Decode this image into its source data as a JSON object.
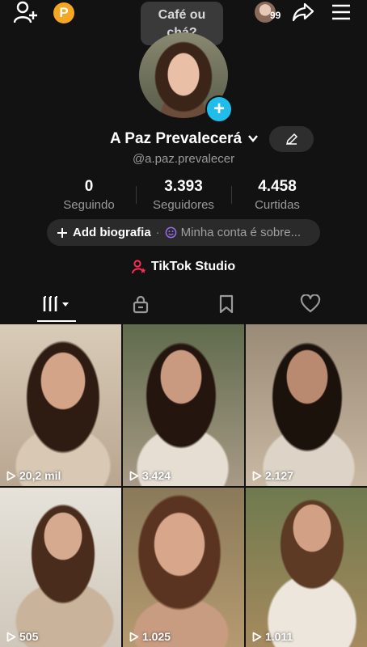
{
  "header": {
    "add_user_icon": "add-user-icon",
    "coin_label": "P",
    "notification_count": "99",
    "share_icon": "share-icon",
    "menu_icon": "hamburger-menu-icon"
  },
  "note_bubble": {
    "line1": "Café ou",
    "line2": "chá?"
  },
  "profile": {
    "display_name": "A Paz Prevalecerá",
    "username": "@a.paz.prevalecer"
  },
  "stats": [
    {
      "value": "0",
      "label": "Seguindo"
    },
    {
      "value": "3.393",
      "label": "Seguidores"
    },
    {
      "value": "4.458",
      "label": "Curtidas"
    }
  ],
  "bio": {
    "add_label": "Add biografia",
    "separator": "·",
    "prompt": "Minha conta é sobre..."
  },
  "studio": {
    "label": "TikTok Studio"
  },
  "tabs": [
    "videos-grid-icon",
    "lock-icon",
    "bookmark-icon",
    "heart-icon"
  ],
  "videos": [
    {
      "views": "20,2 mil"
    },
    {
      "views": "3.424"
    },
    {
      "views": "2.127"
    },
    {
      "views": "505"
    },
    {
      "views": "1.025"
    },
    {
      "views": "1.011"
    }
  ],
  "colors": {
    "background": "#121212",
    "accent_blue": "#20bcea",
    "coin": "#f5a623",
    "studio_pink": "#fe2c55"
  }
}
